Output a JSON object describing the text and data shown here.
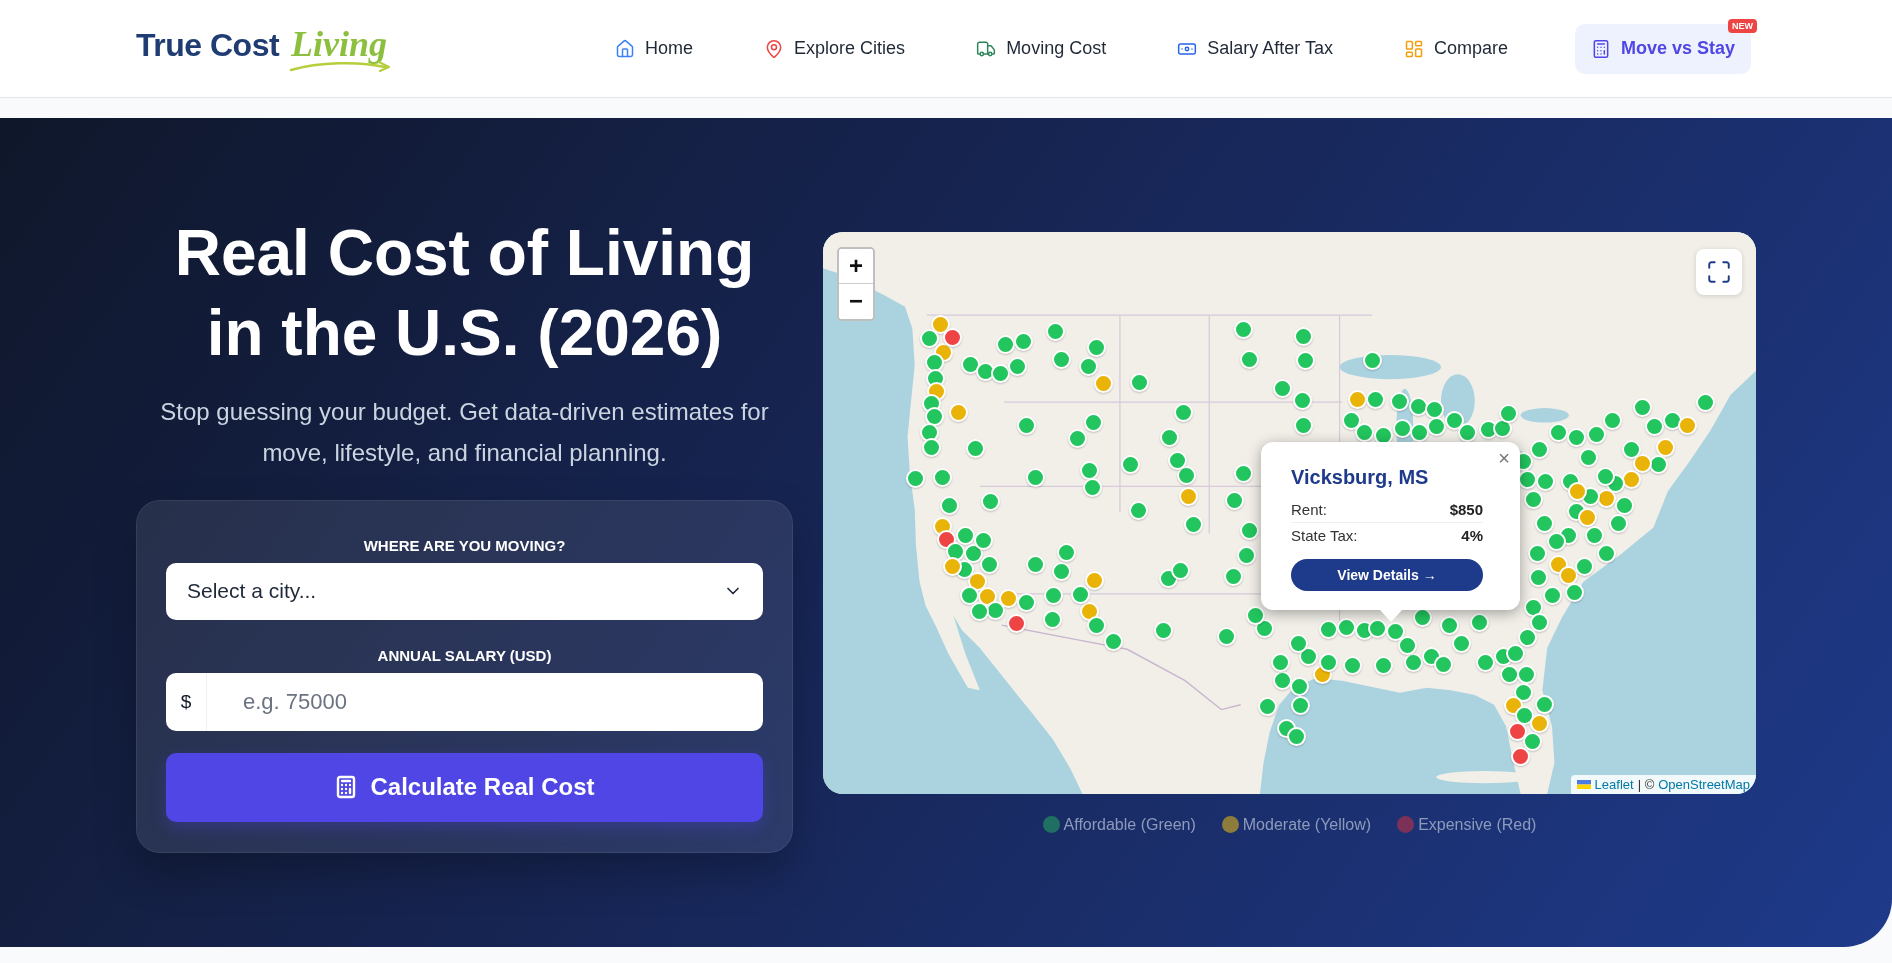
{
  "header": {
    "logo": {
      "primary": "True Cost",
      "accent": "Living"
    },
    "nav": [
      {
        "label": "Home",
        "featured": false
      },
      {
        "label": "Explore Cities",
        "featured": false
      },
      {
        "label": "Moving Cost",
        "featured": false
      },
      {
        "label": "Salary After Tax",
        "featured": false
      },
      {
        "label": "Compare",
        "featured": false
      },
      {
        "label": "Move vs Stay",
        "featured": true,
        "badge": "NEW"
      }
    ]
  },
  "hero": {
    "title": "Real Cost of Living in the U.S. (2026)",
    "subtitle": "Stop guessing your budget. Get data-driven estimates for move, lifestyle, and financial planning."
  },
  "search_form": {
    "fields": [
      {
        "kind": "select",
        "label": "WHERE ARE YOU MOVING?",
        "value": "Select a city..."
      },
      {
        "kind": "currency",
        "label": "ANNUAL SALARY (USD)",
        "prefix": "$",
        "placeholder": "e.g. 75000"
      }
    ],
    "submit": "Calculate Real Cost"
  },
  "map": {
    "zoom_in": "+",
    "zoom_out": "−",
    "markers": [
      {
        "color": "#eab308"
      },
      {
        "color": "#22c55e"
      },
      {
        "color": "#eab308"
      },
      {
        "color": "#ef4444"
      },
      {
        "color": "#22c55e"
      },
      {
        "color": "#22c55e"
      },
      {
        "color": "#eab308"
      },
      {
        "color": "#22c55e"
      },
      {
        "color": "#22c55e"
      },
      {
        "color": "#22c55e"
      },
      {
        "color": "#22c55e"
      },
      {
        "color": "#22c55e"
      },
      {
        "color": "#22c55e"
      },
      {
        "color": "#eab308"
      },
      {
        "color": "#22c55e"
      },
      {
        "color": "#22c55e"
      },
      {
        "color": "#22c55e"
      },
      {
        "color": "#22c55e"
      },
      {
        "color": "#22c55e"
      },
      {
        "color": "#22c55e"
      },
      {
        "color": "#22c55e"
      },
      {
        "color": "#22c55e"
      },
      {
        "color": "#22c55e"
      },
      {
        "color": "#22c55e"
      },
      {
        "color": "#22c55e"
      },
      {
        "color": "#eab308"
      },
      {
        "color": "#22c55e"
      },
      {
        "color": "#22c55e"
      },
      {
        "color": "#22c55e"
      },
      {
        "color": "#22c55e"
      },
      {
        "color": "#22c55e"
      },
      {
        "color": "#22c55e"
      },
      {
        "color": "#22c55e"
      },
      {
        "color": "#22c55e"
      },
      {
        "color": "#22c55e"
      },
      {
        "color": "#22c55e"
      },
      {
        "color": "#22c55e"
      },
      {
        "color": "#22c55e"
      },
      {
        "color": "#eab308"
      },
      {
        "color": "#22c55e"
      },
      {
        "color": "#22c55e"
      },
      {
        "color": "#22c55e"
      },
      {
        "color": "#22c55e"
      },
      {
        "color": "#eab308"
      },
      {
        "color": "#ef4444"
      },
      {
        "color": "#22c55e"
      },
      {
        "color": "#22c55e"
      },
      {
        "color": "#22c55e"
      },
      {
        "color": "#22c55e"
      },
      {
        "color": "#22c55e"
      },
      {
        "color": "#eab308"
      },
      {
        "color": "#22c55e"
      },
      {
        "color": "#eab308"
      },
      {
        "color": "#eab308"
      },
      {
        "color": "#ef4444"
      },
      {
        "color": "#22c55e"
      },
      {
        "color": "#22c55e"
      },
      {
        "color": "#22c55e"
      },
      {
        "color": "#22c55e"
      },
      {
        "color": "#eab308"
      },
      {
        "color": "#22c55e"
      },
      {
        "color": "#22c55e"
      },
      {
        "color": "#22c55e"
      },
      {
        "color": "#eab308"
      },
      {
        "color": "#eab308"
      },
      {
        "color": "#22c55e"
      },
      {
        "color": "#22c55e"
      },
      {
        "color": "#22c55e"
      },
      {
        "color": "#22c55e"
      },
      {
        "color": "#22c55e"
      },
      {
        "color": "#22c55e"
      },
      {
        "color": "#22c55e"
      },
      {
        "color": "#22c55e"
      },
      {
        "color": "#22c55e"
      },
      {
        "color": "#22c55e"
      },
      {
        "color": "#22c55e"
      },
      {
        "color": "#22c55e"
      },
      {
        "color": "#22c55e"
      },
      {
        "color": "#22c55e"
      },
      {
        "color": "#22c55e"
      },
      {
        "color": "#eab308"
      },
      {
        "color": "#22c55e"
      },
      {
        "color": "#22c55e"
      },
      {
        "color": "#22c55e"
      },
      {
        "color": "#22c55e"
      },
      {
        "color": "#22c55e"
      },
      {
        "color": "#22c55e"
      },
      {
        "color": "#22c55e"
      },
      {
        "color": "#22c55e"
      },
      {
        "color": "#22c55e"
      },
      {
        "color": "#22c55e"
      },
      {
        "color": "#22c55e"
      },
      {
        "color": "#22c55e"
      },
      {
        "color": "#22c55e"
      },
      {
        "color": "#22c55e"
      },
      {
        "color": "#22c55e"
      },
      {
        "color": "#22c55e"
      },
      {
        "color": "#22c55e"
      },
      {
        "color": "#22c55e"
      },
      {
        "color": "#22c55e"
      },
      {
        "color": "#22c55e"
      },
      {
        "color": "#22c55e"
      },
      {
        "color": "#22c55e"
      },
      {
        "color": "#22c55e"
      },
      {
        "color": "#22c55e"
      },
      {
        "color": "#22c55e"
      },
      {
        "color": "#22c55e"
      },
      {
        "color": "#eab308"
      },
      {
        "color": "#22c55e"
      },
      {
        "color": "#22c55e"
      },
      {
        "color": "#22c55e"
      },
      {
        "color": "#22c55e"
      },
      {
        "color": "#22c55e"
      },
      {
        "color": "#22c55e"
      },
      {
        "color": "#22c55e"
      },
      {
        "color": "#22c55e"
      },
      {
        "color": "#22c55e"
      },
      {
        "color": "#22c55e"
      },
      {
        "color": "#22c55e"
      },
      {
        "color": "#22c55e"
      },
      {
        "color": "#22c55e"
      },
      {
        "color": "#22c55e"
      },
      {
        "color": "#22c55e"
      },
      {
        "color": "#22c55e"
      },
      {
        "color": "#22c55e"
      },
      {
        "color": "#22c55e"
      },
      {
        "color": "#22c55e"
      },
      {
        "color": "#22c55e"
      },
      {
        "color": "#22c55e"
      },
      {
        "color": "#22c55e"
      },
      {
        "color": "#22c55e"
      },
      {
        "color": "#22c55e"
      },
      {
        "color": "#22c55e"
      },
      {
        "color": "#22c55e"
      },
      {
        "color": "#22c55e"
      },
      {
        "color": "#22c55e"
      },
      {
        "color": "#22c55e"
      },
      {
        "color": "#22c55e"
      },
      {
        "color": "#22c55e"
      },
      {
        "color": "#22c55e"
      },
      {
        "color": "#eab308"
      },
      {
        "color": "#22c55e"
      },
      {
        "color": "#eab308"
      },
      {
        "color": "#22c55e"
      },
      {
        "color": "#eab308"
      },
      {
        "color": "#eab308"
      },
      {
        "color": "#22c55e"
      },
      {
        "color": "#eab308"
      },
      {
        "color": "#22c55e"
      },
      {
        "color": "#22c55e"
      },
      {
        "color": "#22c55e"
      },
      {
        "color": "#eab308"
      },
      {
        "color": "#22c55e"
      },
      {
        "color": "#22c55e"
      },
      {
        "color": "#22c55e"
      },
      {
        "color": "#22c55e"
      },
      {
        "color": "#22c55e"
      },
      {
        "color": "#eab308"
      },
      {
        "color": "#eab308"
      },
      {
        "color": "#22c55e"
      },
      {
        "color": "#22c55e"
      },
      {
        "color": "#22c55e"
      },
      {
        "color": "#22c55e"
      },
      {
        "color": "#22c55e"
      },
      {
        "color": "#22c55e"
      },
      {
        "color": "#22c55e"
      },
      {
        "color": "#22c55e"
      },
      {
        "color": "#22c55e"
      },
      {
        "color": "#eab308"
      },
      {
        "color": "#22c55e"
      },
      {
        "color": "#eab308"
      },
      {
        "color": "#ef4444"
      },
      {
        "color": "#22c55e"
      },
      {
        "color": "#ef4444"
      },
      {
        "color": "#22c55e"
      },
      {
        "color": "#22c55e"
      },
      {
        "color": "#22c55e"
      },
      {
        "color": "#22c55e"
      },
      {
        "color": "#22c55e"
      },
      {
        "color": "#22c55e"
      },
      {
        "color": "#22c55e"
      },
      {
        "color": "#22c55e"
      },
      {
        "color": "#22c55e"
      },
      {
        "color": "#22c55e"
      },
      {
        "color": "#22c55e"
      },
      {
        "color": "#22c55e"
      },
      {
        "color": "#eab308"
      },
      {
        "color": "#22c55e"
      },
      {
        "color": "#22c55e"
      }
    ],
    "popup": {
      "title": "Vicksburg, MS",
      "close": "×",
      "rows": [
        {
          "label": "Rent:",
          "value": "$850"
        },
        {
          "label": "State Tax:",
          "value": "4%"
        }
      ],
      "button": "View Details →"
    },
    "attribution": {
      "links": [
        "Leaflet",
        "OpenStreetMap"
      ],
      "separator": "| ©"
    }
  },
  "legend": [
    {
      "label": "Affordable (Green)",
      "color": "#1f6f62"
    },
    {
      "label": "Moderate (Yellow)",
      "color": "#8e7c3c"
    },
    {
      "label": "Expensive (Red)",
      "color": "#7c3158"
    }
  ]
}
